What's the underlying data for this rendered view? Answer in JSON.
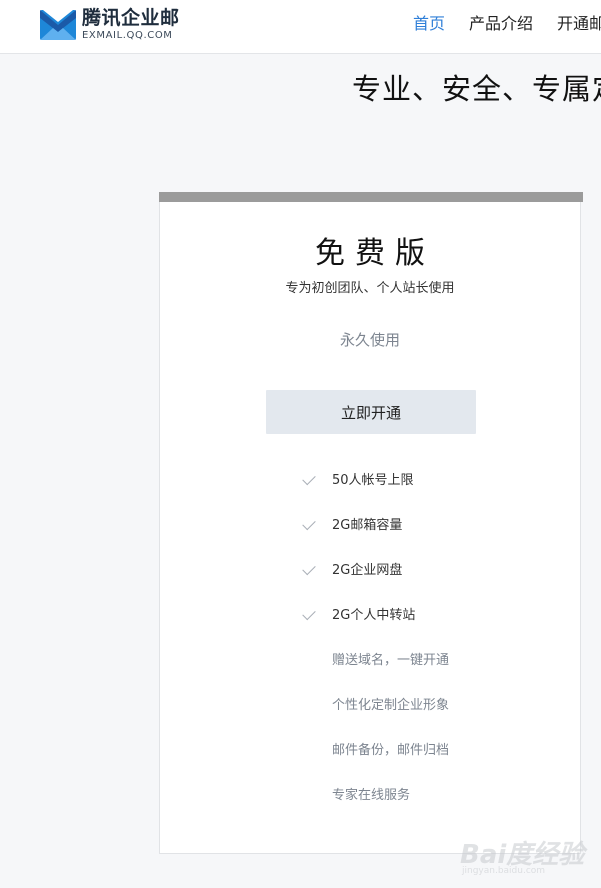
{
  "brand": {
    "name_cn": "腾讯企业邮",
    "domain": "EXMAIL.QQ.COM",
    "colors": {
      "logo_blue": "#1e87d8",
      "logo_dark": "#1b5aa8",
      "accent": "#2f7fd8"
    }
  },
  "nav": {
    "items": [
      {
        "label": "首页",
        "active": true
      },
      {
        "label": "产品介绍",
        "active": false
      },
      {
        "label": "开通邮",
        "active": false
      }
    ]
  },
  "hero": {
    "slogan": "专业、安全、专属定"
  },
  "plan": {
    "name": "免费版",
    "description": "专为初创团队、个人站长使用",
    "duration": "永久使用",
    "cta_label": "立即开通",
    "header_bar_color": "#9b9b9b",
    "features": [
      {
        "text": "50人帐号上限",
        "included": true
      },
      {
        "text": "2G邮箱容量",
        "included": true
      },
      {
        "text": "2G企业网盘",
        "included": true
      },
      {
        "text": "2G个人中转站",
        "included": true
      },
      {
        "text": "赠送域名，一键开通",
        "included": false
      },
      {
        "text": "个性化定制企业形象",
        "included": false
      },
      {
        "text": "邮件备份，邮件归档",
        "included": false
      },
      {
        "text": "专家在线服务",
        "included": false
      }
    ]
  },
  "watermark": {
    "text": "Bai度经验",
    "url": "jingyan.baidu.com"
  }
}
